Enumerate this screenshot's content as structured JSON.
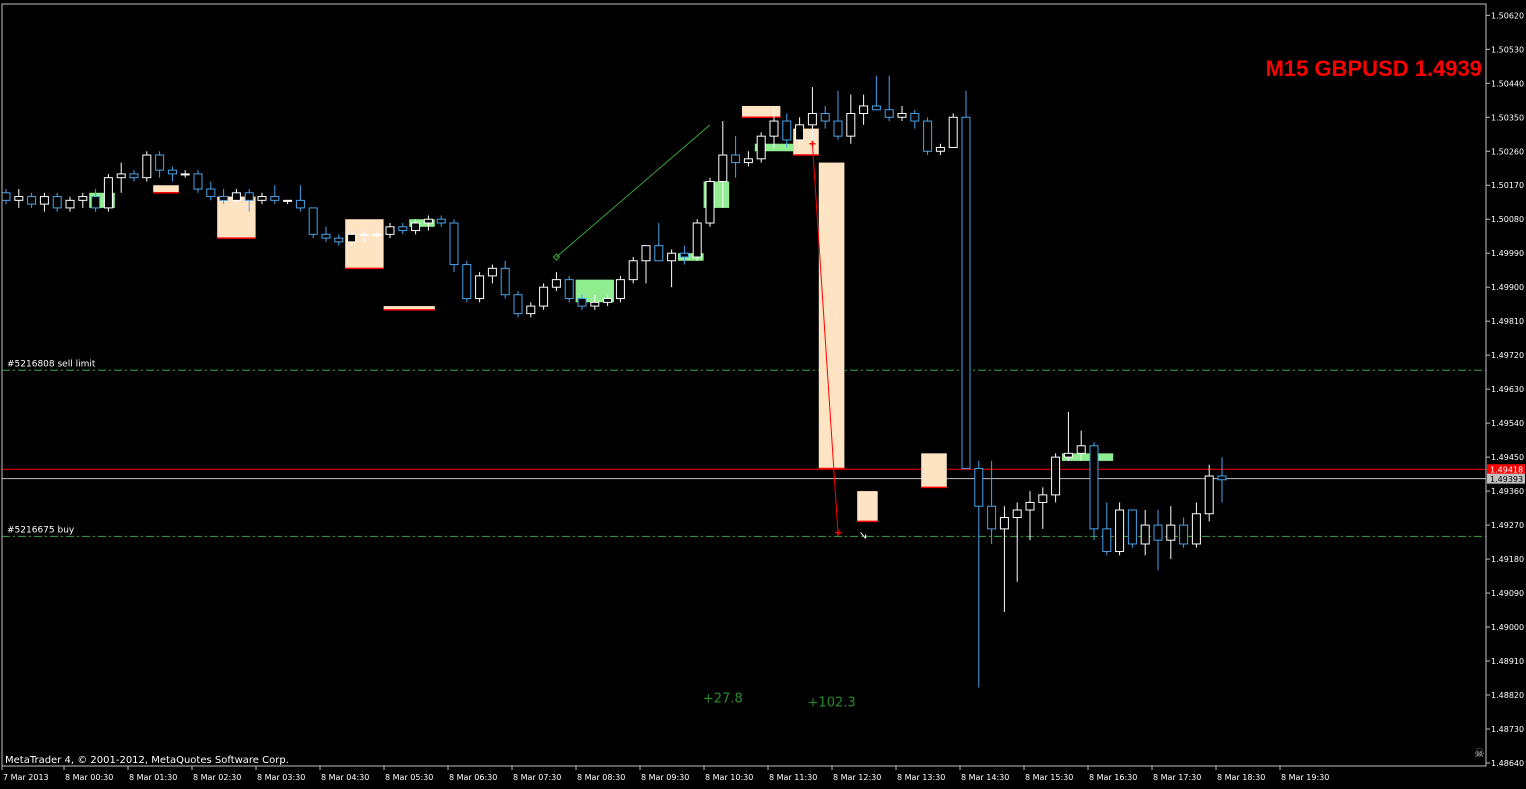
{
  "window": {
    "title": "M15 GBPUSD 1.4939",
    "copyright": "MetaTrader 4, © 2001-2012, MetaQuotes Software Corp.",
    "corner_icon": "skull-icon"
  },
  "colors": {
    "background": "#000000",
    "axis": "#c0c0c0",
    "bull_body": "#000000",
    "bull_border": "#ffffff",
    "bear_body": "#000000",
    "bear_border": "#4aa3e8",
    "profit_box": "#90ee90",
    "loss_box": "#ffe4c4",
    "order_line": "#39a839",
    "stop_line": "#ff0000",
    "bid_line": "#c0c0c0",
    "title": "#ff0000",
    "profit_label": "#2a8a2a"
  },
  "chart_data": {
    "type": "candlestick",
    "symbol": "GBPUSD",
    "timeframe": "M15",
    "ylim": [
      1.4864,
      1.5065
    ],
    "y_ticks": [
      "1.50620",
      "1.50530",
      "1.50440",
      "1.50350",
      "1.50260",
      "1.50170",
      "1.50080",
      "1.49990",
      "1.49900",
      "1.49810",
      "1.49720",
      "1.49630",
      "1.49540",
      "1.49450",
      "1.49360",
      "1.49270",
      "1.49180",
      "1.49090",
      "1.49000",
      "1.48910",
      "1.48820",
      "1.48730",
      "1.48640"
    ],
    "x_ticks": [
      "7 Mar 2013",
      "8 Mar 00:30",
      "8 Mar 01:30",
      "8 Mar 02:30",
      "8 Mar 03:30",
      "8 Mar 04:30",
      "8 Mar 05:30",
      "8 Mar 06:30",
      "8 Mar 07:30",
      "8 Mar 08:30",
      "8 Mar 09:30",
      "8 Mar 10:30",
      "8 Mar 11:30",
      "8 Mar 12:30",
      "8 Mar 13:30",
      "8 Mar 14:30",
      "8 Mar 15:30",
      "8 Mar 16:30",
      "8 Mar 17:30",
      "8 Mar 18:30",
      "8 Mar 19:30"
    ],
    "candles": [
      [
        1.5015,
        1.5016,
        1.5012,
        1.5013
      ],
      [
        1.5013,
        1.5016,
        1.5011,
        1.5014
      ],
      [
        1.5014,
        1.5015,
        1.5011,
        1.5012
      ],
      [
        1.5012,
        1.5015,
        1.501,
        1.5014
      ],
      [
        1.5014,
        1.5015,
        1.501,
        1.5011
      ],
      [
        1.5011,
        1.5014,
        1.501,
        1.5013
      ],
      [
        1.5013,
        1.5015,
        1.5011,
        1.5014
      ],
      [
        1.5014,
        1.5016,
        1.501,
        1.5011
      ],
      [
        1.5011,
        1.502,
        1.501,
        1.5019
      ],
      [
        1.5019,
        1.5023,
        1.5015,
        1.502
      ],
      [
        1.502,
        1.5021,
        1.5018,
        1.5019
      ],
      [
        1.5019,
        1.5026,
        1.5018,
        1.5025
      ],
      [
        1.5025,
        1.5026,
        1.5019,
        1.5021
      ],
      [
        1.5021,
        1.5022,
        1.5018,
        1.502
      ],
      [
        1.502,
        1.5021,
        1.5019,
        1.502
      ],
      [
        1.502,
        1.5021,
        1.5015,
        1.5016
      ],
      [
        1.5016,
        1.5018,
        1.5013,
        1.5014
      ],
      [
        1.5014,
        1.5016,
        1.5012,
        1.5013
      ],
      [
        1.5013,
        1.5016,
        1.5012,
        1.5015
      ],
      [
        1.5015,
        1.5016,
        1.501,
        1.5013
      ],
      [
        1.5013,
        1.5015,
        1.5012,
        1.5014
      ],
      [
        1.5014,
        1.5017,
        1.5012,
        1.5013
      ],
      [
        1.5013,
        1.5013,
        1.5012,
        1.5013
      ],
      [
        1.5013,
        1.5017,
        1.501,
        1.5011
      ],
      [
        1.5011,
        1.5011,
        1.5003,
        1.5004
      ],
      [
        1.5004,
        1.5006,
        1.5002,
        1.5003
      ],
      [
        1.5003,
        1.5004,
        1.5001,
        1.5002
      ],
      [
        1.5002,
        1.5005,
        1.5001,
        1.5004
      ],
      [
        1.5004,
        1.5005,
        1.5002,
        1.5004
      ],
      [
        1.5004,
        1.5005,
        1.5003,
        1.5004
      ],
      [
        1.5004,
        1.5007,
        1.5003,
        1.5006
      ],
      [
        1.5006,
        1.5007,
        1.5004,
        1.5005
      ],
      [
        1.5005,
        1.5008,
        1.5004,
        1.5007
      ],
      [
        1.5007,
        1.5009,
        1.5005,
        1.5008
      ],
      [
        1.5008,
        1.5009,
        1.5006,
        1.5007
      ],
      [
        1.5007,
        1.5008,
        1.4994,
        1.4996
      ],
      [
        1.4996,
        1.4997,
        1.4986,
        1.4987
      ],
      [
        1.4987,
        1.4994,
        1.4986,
        1.4993
      ],
      [
        1.4993,
        1.4996,
        1.4991,
        1.4995
      ],
      [
        1.4995,
        1.4997,
        1.4987,
        1.4988
      ],
      [
        1.4988,
        1.4989,
        1.4982,
        1.4983
      ],
      [
        1.4983,
        1.4986,
        1.4982,
        1.4985
      ],
      [
        1.4985,
        1.4991,
        1.4984,
        1.499
      ],
      [
        1.499,
        1.4994,
        1.4989,
        1.4992
      ],
      [
        1.4992,
        1.4993,
        1.4986,
        1.4987
      ],
      [
        1.4987,
        1.4988,
        1.4984,
        1.4985
      ],
      [
        1.4985,
        1.4988,
        1.4984,
        1.4986
      ],
      [
        1.4986,
        1.4988,
        1.4985,
        1.4987
      ],
      [
        1.4987,
        1.4993,
        1.4986,
        1.4992
      ],
      [
        1.4992,
        1.4998,
        1.4991,
        1.4997
      ],
      [
        1.4997,
        1.5001,
        1.4991,
        1.5001
      ],
      [
        1.5001,
        1.5007,
        1.5,
        1.4997
      ],
      [
        1.4997,
        1.5,
        1.499,
        1.4999
      ],
      [
        1.4999,
        1.5001,
        1.4996,
        1.4998
      ],
      [
        1.4998,
        1.5008,
        1.4997,
        1.5007
      ],
      [
        1.5007,
        1.5019,
        1.5006,
        1.5018
      ],
      [
        1.5018,
        1.5034,
        1.5011,
        1.5025
      ],
      [
        1.5025,
        1.503,
        1.5019,
        1.5023
      ],
      [
        1.5023,
        1.5026,
        1.5022,
        1.5024
      ],
      [
        1.5024,
        1.5031,
        1.5023,
        1.503
      ],
      [
        1.503,
        1.5037,
        1.5027,
        1.5034
      ],
      [
        1.5034,
        1.5036,
        1.5027,
        1.5029
      ],
      [
        1.5029,
        1.5035,
        1.5027,
        1.5033
      ],
      [
        1.5033,
        1.5043,
        1.5029,
        1.5036
      ],
      [
        1.5036,
        1.5038,
        1.5032,
        1.5034
      ],
      [
        1.5034,
        1.5042,
        1.5029,
        1.503
      ],
      [
        1.503,
        1.5041,
        1.5028,
        1.5036
      ],
      [
        1.5036,
        1.5041,
        1.5033,
        1.5038
      ],
      [
        1.5038,
        1.5046,
        1.5037,
        1.5037
      ],
      [
        1.5037,
        1.5046,
        1.5034,
        1.5035
      ],
      [
        1.5035,
        1.5038,
        1.5034,
        1.5036
      ],
      [
        1.5036,
        1.5037,
        1.5032,
        1.5034
      ],
      [
        1.5034,
        1.5035,
        1.5025,
        1.5026
      ],
      [
        1.5026,
        1.5028,
        1.5025,
        1.5027
      ],
      [
        1.5027,
        1.5036,
        1.5027,
        1.5035
      ],
      [
        1.5035,
        1.5042,
        1.4942,
        1.4942
      ],
      [
        1.4942,
        1.4944,
        1.4884,
        1.4932
      ],
      [
        1.4932,
        1.4944,
        1.4922,
        1.4926
      ],
      [
        1.4926,
        1.4932,
        1.4904,
        1.4929
      ],
      [
        1.4929,
        1.4933,
        1.4912,
        1.4931
      ],
      [
        1.4931,
        1.4936,
        1.4923,
        1.4933
      ],
      [
        1.4933,
        1.4937,
        1.4926,
        1.4935
      ],
      [
        1.4935,
        1.4946,
        1.4933,
        1.4945
      ],
      [
        1.4945,
        1.4957,
        1.4944,
        1.4946
      ],
      [
        1.4946,
        1.4952,
        1.4944,
        1.4948
      ],
      [
        1.4948,
        1.4949,
        1.4923,
        1.4926
      ],
      [
        1.4926,
        1.4933,
        1.4919,
        1.492
      ],
      [
        1.492,
        1.4933,
        1.4919,
        1.4931
      ],
      [
        1.4931,
        1.4931,
        1.4921,
        1.4922
      ],
      [
        1.4922,
        1.4931,
        1.4919,
        1.4927
      ],
      [
        1.4927,
        1.4931,
        1.4915,
        1.4923
      ],
      [
        1.4923,
        1.4932,
        1.4918,
        1.4927
      ],
      [
        1.4927,
        1.4929,
        1.4921,
        1.4922
      ],
      [
        1.4922,
        1.4933,
        1.4921,
        1.493
      ],
      [
        1.493,
        1.4943,
        1.4928,
        1.494
      ],
      [
        1.494,
        1.4945,
        1.4933,
        1.4939
      ]
    ],
    "profit_boxes": [
      {
        "from": 7,
        "to": 8,
        "top": 1.5015,
        "bottom": 1.5011
      },
      {
        "from": 32,
        "to": 33,
        "top": 1.5008,
        "bottom": 1.5006
      },
      {
        "from": 45,
        "to": 47,
        "top": 1.4992,
        "bottom": 1.4986
      },
      {
        "from": 53,
        "to": 54,
        "top": 1.4999,
        "bottom": 1.4997
      },
      {
        "from": 55,
        "to": 56,
        "top": 1.5018,
        "bottom": 1.5011
      },
      {
        "from": 59,
        "to": 61,
        "top": 1.5028,
        "bottom": 1.5026
      },
      {
        "from": 83,
        "to": 86,
        "top": 1.4946,
        "bottom": 1.4944
      }
    ],
    "loss_boxes": [
      {
        "from": 12,
        "to": 13,
        "top": 1.5017,
        "bottom": 1.5015
      },
      {
        "from": 17,
        "to": 19,
        "top": 1.5014,
        "bottom": 1.5003
      },
      {
        "from": 27,
        "to": 29,
        "top": 1.5008,
        "bottom": 1.4995
      },
      {
        "from": 30,
        "to": 33,
        "top": 1.4985,
        "bottom": 1.4984
      },
      {
        "from": 58,
        "to": 60,
        "top": 1.5038,
        "bottom": 1.5035
      },
      {
        "from": 62,
        "to": 63,
        "top": 1.5032,
        "bottom": 1.5025
      },
      {
        "from": 64,
        "to": 65,
        "top": 1.5023,
        "bottom": 1.4942
      },
      {
        "from": 67,
        "to": 67.6,
        "top": 1.4936,
        "bottom": 1.4928
      },
      {
        "from": 72,
        "to": 73,
        "top": 1.4946,
        "bottom": 1.4937
      }
    ],
    "trade_lines": [
      {
        "from_idx": 43,
        "from_price": 1.4998,
        "to_idx": 55,
        "to_price": 1.5033,
        "color": "green"
      },
      {
        "from_idx": 63,
        "from_price": 1.5028,
        "to_idx": 65,
        "to_price": 1.4925,
        "color": "red"
      }
    ],
    "trade_markers": [
      {
        "idx": 43,
        "price": 1.4998,
        "kind": "diamond"
      },
      {
        "idx": 63,
        "price": 1.5028,
        "kind": "cross"
      },
      {
        "idx": 65,
        "price": 1.4925,
        "kind": "cross"
      },
      {
        "idx": 67,
        "price": 1.4924,
        "kind": "arrow"
      }
    ],
    "horizontal_lines": [
      {
        "price": 1.4968,
        "style": "dashdot",
        "color": "#39a839",
        "label": "#5216808 sell limit"
      },
      {
        "price": 1.49418,
        "style": "solid",
        "color": "#ff0000",
        "label": "",
        "tag": "1.49418"
      },
      {
        "price": 1.49393,
        "style": "solid",
        "color": "#c0c0c0",
        "label": "",
        "tag": "1.49393"
      },
      {
        "price": 1.4924,
        "style": "dashdot",
        "color": "#39a839",
        "label": "#5216675 buy"
      }
    ],
    "profit_labels": [
      {
        "text": "+27.8",
        "idx": 56,
        "price": 1.488
      },
      {
        "text": "+102.3",
        "idx": 64.5,
        "price": 1.4879
      }
    ]
  }
}
